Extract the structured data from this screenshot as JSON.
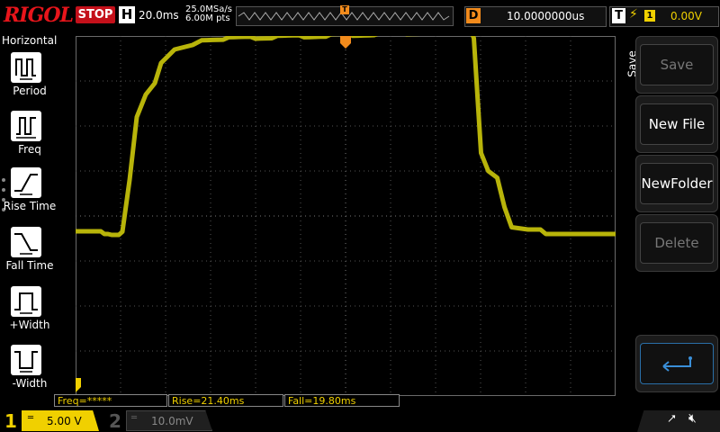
{
  "topbar": {
    "logo": "RIGOL",
    "run_state": "STOP",
    "horizontal_label": "H",
    "timebase": "20.0ms",
    "sample_rate": "25.0MSa/s",
    "memory_depth": "6.00M pts",
    "trigger_marker": "T",
    "delay_label": "D",
    "delay_value": "10.0000000us",
    "trigger_label": "T",
    "trigger_edge_icon": "rising-edge-icon",
    "trigger_source": "1",
    "trigger_level": "0.00V"
  },
  "left_menu": {
    "title": "Horizontal",
    "items": [
      {
        "label": "Period",
        "icon": "period-icon"
      },
      {
        "label": "Freq",
        "icon": "frequency-icon"
      },
      {
        "label": "Rise Time",
        "icon": "rise-time-icon"
      },
      {
        "label": "Fall Time",
        "icon": "fall-time-icon"
      },
      {
        "label": "+Width",
        "icon": "positive-width-icon"
      },
      {
        "label": "-Width",
        "icon": "negative-width-icon"
      }
    ]
  },
  "right_menu": {
    "title": "Save",
    "buttons": [
      {
        "label": "Save",
        "enabled": false
      },
      {
        "label": "New File",
        "enabled": true
      },
      {
        "label": "NewFolder",
        "enabled": true
      },
      {
        "label": "Delete",
        "enabled": false
      }
    ],
    "back_icon": "return-arrow-icon"
  },
  "measurements": {
    "freq": "Freq=*****",
    "rise": "Rise=21.40ms",
    "fall": "Fall=19.80ms"
  },
  "channels": {
    "ch1_number": "1",
    "ch1_scale": "5.00 V",
    "ch2_number": "2",
    "ch2_scale": "10.0mV"
  },
  "status_icons": [
    "usb-icon",
    "speaker-muted-icon"
  ],
  "colors": {
    "ch1": "#f0d000",
    "trace": "#b8b40a",
    "trigger": "#f28b1c",
    "stop": "#c4101a",
    "logo": "#e8151b"
  },
  "waveform": {
    "channel": "1",
    "low_level_divisions": -0.4,
    "high_level_divisions": 3.95,
    "rise_start_divisions": -5.0,
    "fall_start_divisions": 2.85
  }
}
